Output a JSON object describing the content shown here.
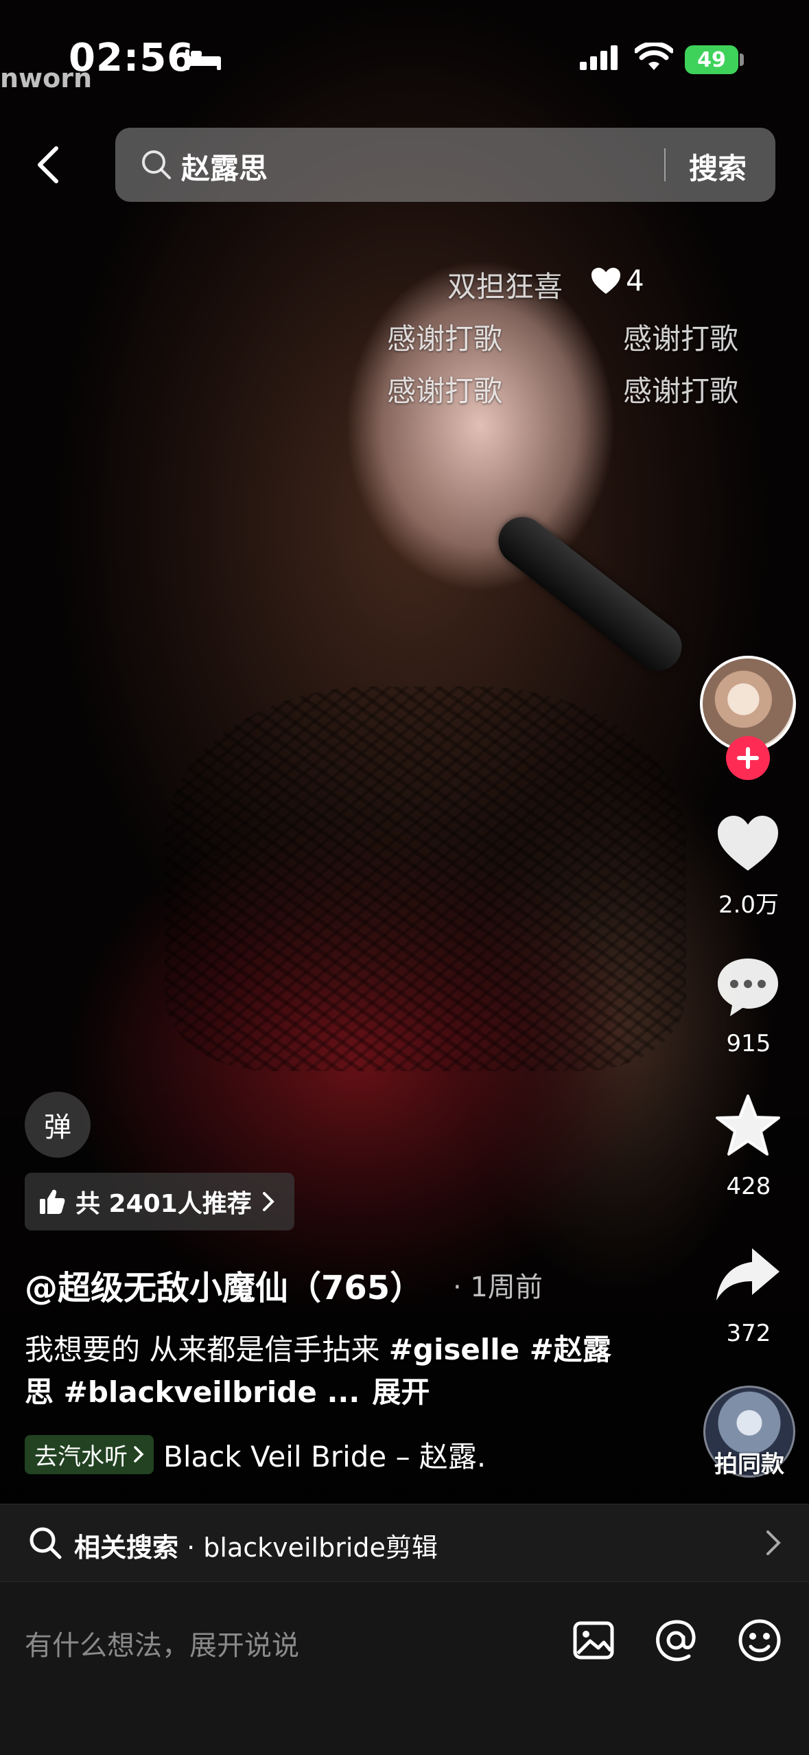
{
  "status_bar": {
    "time": "02:56",
    "battery": "49",
    "watermark": "nworn"
  },
  "search": {
    "query": "赵露思",
    "button": "搜索"
  },
  "danmaku": [
    {
      "text": "双担狂喜",
      "likes": "4"
    },
    {
      "text": "感谢打歌"
    },
    {
      "text": "感谢打歌"
    },
    {
      "text": "感谢打歌"
    },
    {
      "text": "感谢打歌"
    }
  ],
  "actions": {
    "likes": "2.0万",
    "comments": "915",
    "favorites": "428",
    "shares": "372",
    "same_style": "拍同款"
  },
  "overlay": {
    "danmu_toggle": "弹",
    "recommend_text": "共 2401人推荐",
    "author": "@超级无敌小魔仙（765）",
    "post_time": "· 1周前",
    "desc_text": "我想要的 从来都是信手拈来 ",
    "desc_tags": "#giselle #赵露思 #blackveilbride ...",
    "desc_expand": "展开",
    "music_badge": "去汽水听",
    "music_title": "Black Veil Bride – 赵露."
  },
  "related": {
    "label": "相关搜索",
    "sep": " · ",
    "query": "blackveilbride剪辑"
  },
  "comment": {
    "placeholder": "有什么想法，展开说说"
  },
  "colors": {
    "accent": "#fe2c55",
    "battery": "#3fd25b"
  }
}
